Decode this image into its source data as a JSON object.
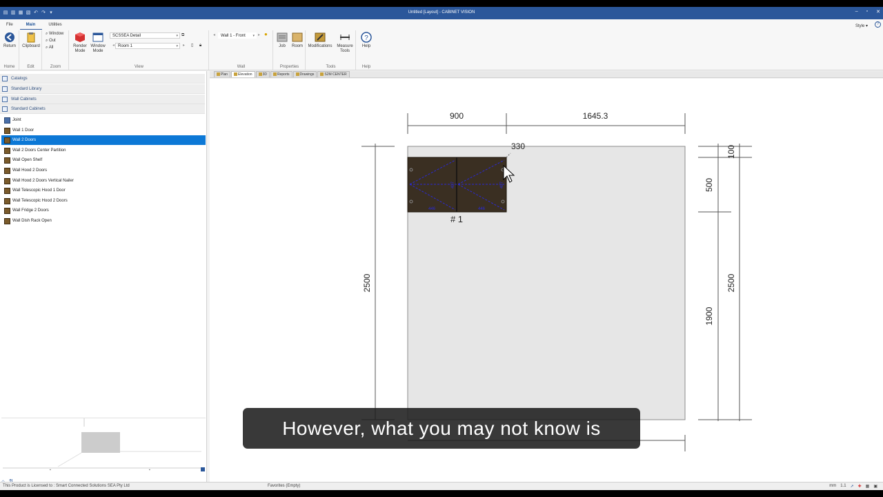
{
  "window": {
    "title": "Untitled [Layout] - CABINET VISION",
    "controls": [
      "–",
      "▫",
      "✕"
    ]
  },
  "ribbon": {
    "tabs": [
      "File",
      "Main",
      "Utilities"
    ],
    "active_tab": "Main",
    "style_label": "Style",
    "groups": {
      "home": {
        "label": "Home",
        "return_label": "Return"
      },
      "edit": {
        "label": "Edit",
        "clipboard_label": "Clipboard"
      },
      "zoom": {
        "label": "Zoom",
        "window_label": "Window",
        "out_label": "Out",
        "all_label": "All"
      },
      "view": {
        "label": "View",
        "render_label": "Render Mode",
        "window_mode_label": "Window Mode",
        "detail_select": "SCSSEA Detail",
        "room_select": "Room 1"
      },
      "wall": {
        "label": "Wall",
        "wall_select": "Wall 1 - Front"
      },
      "properties": {
        "label": "Properties",
        "job_label": "Job",
        "room_label": "Room"
      },
      "tools": {
        "label": "Tools",
        "modifications_label": "Modifications",
        "measure_label": "Measure Tools"
      },
      "help": {
        "label": "Help",
        "help_label": "Help"
      }
    }
  },
  "sidebar": {
    "catalogs": [
      "Catalogs",
      "Standard Library",
      "Wall Cabinets",
      "Standard Cabinets"
    ],
    "items": [
      {
        "label": "Joint",
        "type": "joint"
      },
      {
        "label": "Wall 1 Door",
        "type": "cab"
      },
      {
        "label": "Wall 2 Doors",
        "type": "cab",
        "selected": true
      },
      {
        "label": "Wall 2 Doors Center Partition",
        "type": "cab"
      },
      {
        "label": "Wall Open Shelf",
        "type": "cab"
      },
      {
        "label": "Wall Hood 2 Doors",
        "type": "cab"
      },
      {
        "label": "Wall Hood 2 Doors Vertical Nailer",
        "type": "cab"
      },
      {
        "label": "Wall Telescopic Hood 1 Door",
        "type": "cab"
      },
      {
        "label": "Wall Telescopic Hood 2 Doors",
        "type": "cab"
      },
      {
        "label": "Wall Fridge 2 Doors",
        "type": "cab"
      },
      {
        "label": "Wall Dish Rack Open",
        "type": "cab"
      }
    ]
  },
  "doc_tabs": [
    "Plan",
    "Elevation",
    "3D",
    "Reports",
    "Drawings",
    "S2M CENTER"
  ],
  "active_doc_tab": "Elevation",
  "drawing": {
    "dims": {
      "top_left": "900",
      "top_right": "1645.3",
      "cursor_dim": "330",
      "left_height": "2500",
      "right_100": "100",
      "right_500": "500",
      "right_1900": "1900",
      "right_2500": "2500"
    },
    "cabinet_label": "# 1",
    "door_dims": [
      "446",
      "446",
      "497",
      "497"
    ]
  },
  "status": {
    "license": "This Product is Licensed to : Smart Connected Solutions SEA Pty Ltd",
    "favorites": "Favorites (Empty)",
    "units": "mm",
    "scale": "1.1"
  },
  "caption": "However, what you may not know is",
  "colors": {
    "accent": "#2b579a",
    "selection": "#0c78d6",
    "cabinet_fill": "#3a2f22",
    "dimension_line": "#333333",
    "door_marks": "#2a2ad8"
  }
}
